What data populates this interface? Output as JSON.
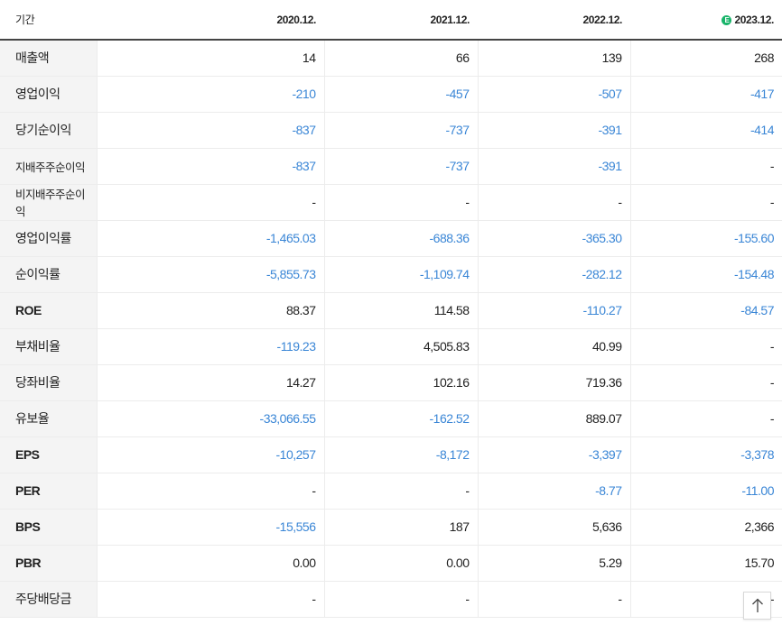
{
  "table": {
    "header": {
      "label": "기간",
      "periods": [
        "2020.12.",
        "2021.12.",
        "2022.12.",
        "2023.12."
      ],
      "estimate_badge": "E"
    },
    "rows": [
      {
        "label": "매출액",
        "values": [
          "14",
          "66",
          "139",
          "268"
        ]
      },
      {
        "label": "영업이익",
        "values": [
          "-210",
          "-457",
          "-507",
          "-417"
        ]
      },
      {
        "label": "당기순이익",
        "values": [
          "-837",
          "-737",
          "-391",
          "-414"
        ]
      },
      {
        "label": "지배주주순이익",
        "values": [
          "-837",
          "-737",
          "-391",
          "-"
        ]
      },
      {
        "label": "비지배주주순이익",
        "values": [
          "-",
          "-",
          "-",
          "-"
        ]
      },
      {
        "label": "영업이익률",
        "values": [
          "-1,465.03",
          "-688.36",
          "-365.30",
          "-155.60"
        ]
      },
      {
        "label": "순이익률",
        "values": [
          "-5,855.73",
          "-1,109.74",
          "-282.12",
          "-154.48"
        ]
      },
      {
        "label": "ROE",
        "values": [
          "88.37",
          "114.58",
          "-110.27",
          "-84.57"
        ]
      },
      {
        "label": "부채비율",
        "values": [
          "-119.23",
          "4,505.83",
          "40.99",
          "-"
        ]
      },
      {
        "label": "당좌비율",
        "values": [
          "14.27",
          "102.16",
          "719.36",
          "-"
        ]
      },
      {
        "label": "유보율",
        "values": [
          "-33,066.55",
          "-162.52",
          "889.07",
          "-"
        ]
      },
      {
        "label": "EPS",
        "values": [
          "-10,257",
          "-8,172",
          "-3,397",
          "-3,378"
        ]
      },
      {
        "label": "PER",
        "values": [
          "-",
          "-",
          "-8.77",
          "-11.00"
        ]
      },
      {
        "label": "BPS",
        "values": [
          "-15,556",
          "187",
          "5,636",
          "2,366"
        ]
      },
      {
        "label": "PBR",
        "values": [
          "0.00",
          "0.00",
          "5.29",
          "15.70"
        ]
      },
      {
        "label": "주당배당금",
        "values": [
          "-",
          "-",
          "-",
          "-"
        ]
      }
    ]
  },
  "colors": {
    "negative": "#3a86d6",
    "positive": "#222222",
    "estimate_badge": "#19b46a",
    "label_background": "#f4f4f4"
  },
  "icons": {
    "scroll_top": "arrow-up-icon",
    "estimate": "estimate-badge-icon"
  }
}
